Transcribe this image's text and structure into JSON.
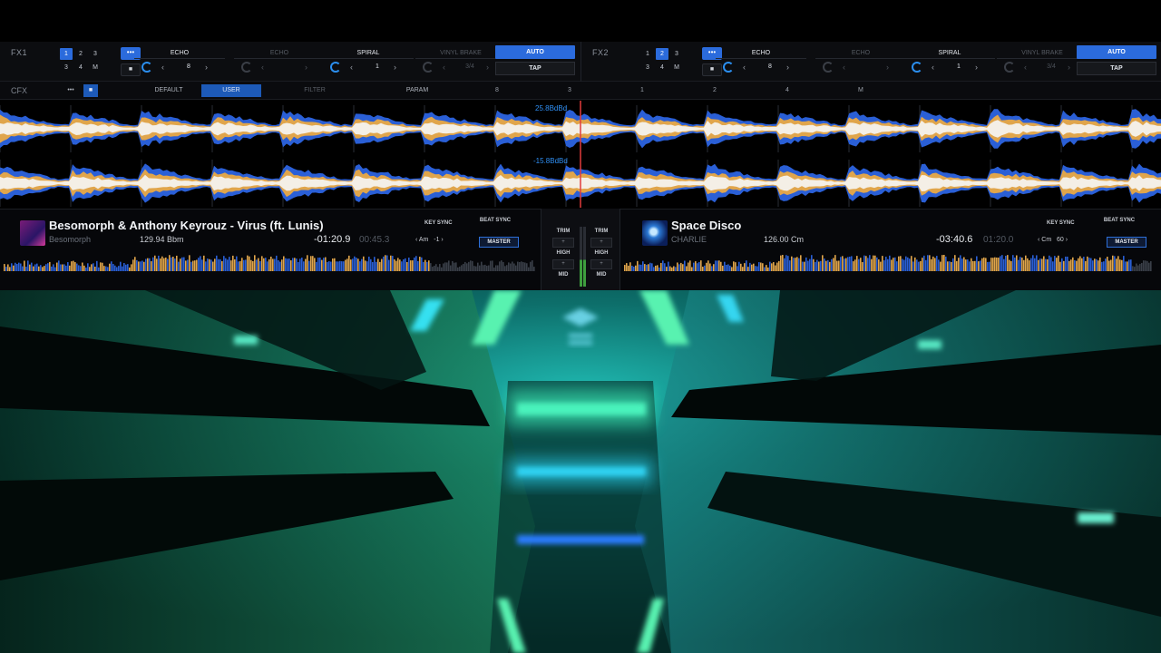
{
  "fx_units": [
    {
      "name": "FX1",
      "numbers": [
        "1",
        "2",
        "3",
        "3",
        "4",
        "M"
      ],
      "selected_index": 0,
      "menu_icon": "dots-icon",
      "small_button": "■",
      "slots": [
        {
          "title": "ECHO",
          "value": "8",
          "active": true
        },
        {
          "title": "ECHO",
          "value": "",
          "active": false
        },
        {
          "title": "SPIRAL",
          "value": "1",
          "active": true
        },
        {
          "title": "VINYL BRAKE",
          "value": "3/4",
          "active": false
        }
      ],
      "auto_label": "AUTO",
      "tap_label": "TAP"
    },
    {
      "name": "FX2",
      "numbers": [
        "1",
        "2",
        "3",
        "3",
        "4",
        "M"
      ],
      "selected_index": 1,
      "menu_icon": "dots-icon",
      "small_button": "■",
      "slots": [
        {
          "title": "ECHO",
          "value": "8",
          "active": true
        },
        {
          "title": "ECHO",
          "value": "",
          "active": false
        },
        {
          "title": "SPIRAL",
          "value": "1",
          "active": true
        },
        {
          "title": "VINYL BRAKE",
          "value": "3/4",
          "active": false
        }
      ],
      "auto_label": "AUTO",
      "tap_label": "TAP"
    }
  ],
  "cfx": {
    "label": "CFX",
    "buttons": [
      {
        "label": "•••",
        "state": "normal"
      },
      {
        "label": "■",
        "state": "selected"
      },
      {
        "label": "DEFAULT",
        "state": "normal"
      },
      {
        "label": "USER",
        "state": "selected"
      },
      {
        "label": "FILTER",
        "state": "dim"
      },
      {
        "label": "PARAM",
        "state": "normal"
      }
    ],
    "beats": [
      "8",
      "3",
      "1",
      "2",
      "4",
      "M"
    ]
  },
  "waveforms": {
    "deck1_bpm_label": "25.8BdBd",
    "deck2_bpm_label": "-15.8BdBd",
    "colors": {
      "high": "#f4efe6",
      "mid": "#e0a54b",
      "low": "#2a5fd6"
    }
  },
  "decks": [
    {
      "title": "Besomorph & Anthony Keyrouz - Virus (ft. Lunis)",
      "artist": "Besomorph",
      "bpm": "129.94 Bbm",
      "time_remaining": "-01:20.9",
      "time_elapsed": "00:45.3",
      "key_sync_label": "KEY SYNC",
      "key": "Am",
      "key_shift": "-1",
      "beat_sync_label": "BEAT SYNC",
      "master_label": "MASTER"
    },
    {
      "title": "Space Disco",
      "artist": "CHARLIE",
      "bpm": "126.00 Cm",
      "time_remaining": "-03:40.6",
      "time_elapsed": "01:20.0",
      "key_sync_label": "KEY SYNC",
      "key": "Cm",
      "key_shift": "60",
      "beat_sync_label": "BEAT SYNC",
      "master_label": "MASTER"
    }
  ],
  "mixer": {
    "labels": [
      "TRIM",
      "HIGH",
      "MID"
    ],
    "trim_box": "+",
    "high_box": "+"
  },
  "scene": {
    "description_colors": {
      "green": "#36e88a",
      "cyan": "#3ad6f0",
      "blue": "#2b7cff"
    }
  }
}
